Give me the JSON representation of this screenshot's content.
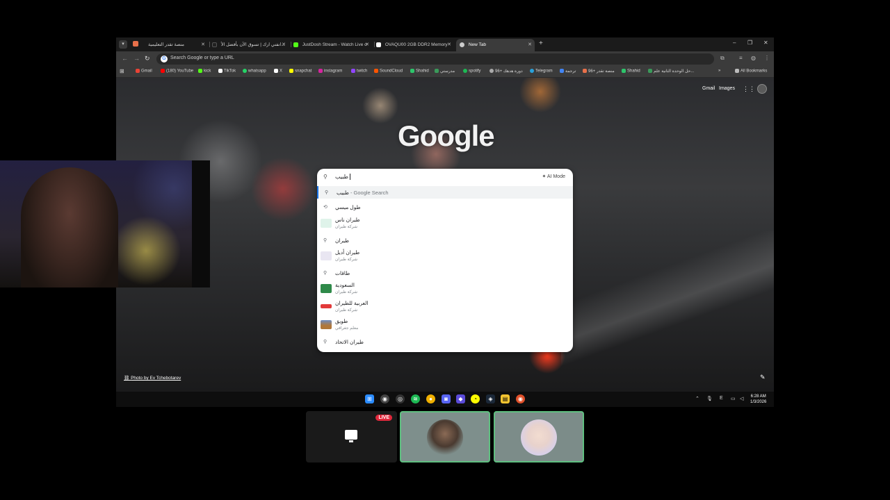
{
  "tabs": [
    {
      "title": "منصة تقدر التعليمية",
      "favicon_color": "#e8704a"
    },
    {
      "title": "انفني ارك | تسوق الآن بأفضل الأ...",
      "favicon_color": "#222222"
    },
    {
      "title": "JustDosh Stream - Watch Live o",
      "favicon_color": "#53fc18"
    },
    {
      "title": "OVAQU00 2GB DDR2 Memory",
      "favicon_color": "#ffffff"
    },
    {
      "title": "New Tab",
      "favicon_color": "#cccccc",
      "active": true
    }
  ],
  "omnibox": {
    "placeholder": "Search Google or type a URL"
  },
  "bookmarks": [
    {
      "label": "Gmail",
      "color": "#ea4335"
    },
    {
      "label": "(180) YouTube",
      "color": "#ff0000"
    },
    {
      "label": "kick",
      "color": "#53fc18"
    },
    {
      "label": "TikTok",
      "color": "#ffffff"
    },
    {
      "label": "whatsapp",
      "color": "#25d366"
    },
    {
      "label": "X",
      "color": "#ffffff"
    },
    {
      "label": "snapchat",
      "color": "#fffc00"
    },
    {
      "label": "instagram",
      "color": "#d6249f"
    },
    {
      "label": "twitch",
      "color": "#9146ff"
    },
    {
      "label": "SoundCloud",
      "color": "#ff5500"
    },
    {
      "label": "Shahid",
      "color": "#2ec46b"
    },
    {
      "label": "مدرستي",
      "color": "#3a9a5a"
    },
    {
      "label": "spotify",
      "color": "#1db954"
    },
    {
      "label": "دورة هدهك +96",
      "color": "#aaaaaa"
    },
    {
      "label": "Telegram",
      "color": "#2aa1da"
    },
    {
      "label": "ترجمة",
      "color": "#4285f4"
    },
    {
      "label": "منصة تقدر +96",
      "color": "#e8704a"
    },
    {
      "label": "Shahid",
      "color": "#2ec46b"
    },
    {
      "label": "حل الوحدة الثانية علم...",
      "color": "#3a9a5a"
    }
  ],
  "bookmarks_all": "All Bookmarks",
  "header_links": {
    "gmail": "Gmail",
    "images": "Images"
  },
  "logo_text": "Google",
  "photo_credit": "Photo by Ev Tchebotarev",
  "search": {
    "query": "طبيب",
    "ai_mode": "AI Mode"
  },
  "suggestions": [
    {
      "icon": "search",
      "text": "طبيب",
      "hint": " - Google Search",
      "selected": true
    },
    {
      "icon": "history",
      "text": "طول ميسي"
    },
    {
      "icon": "thumb",
      "text": "طيران ناس",
      "sub": "شركة طيران",
      "thumb_color": "#dff3ea"
    },
    {
      "icon": "search",
      "text": "طيران"
    },
    {
      "icon": "thumb",
      "text": "طيران أديل",
      "sub": "شركة طيران",
      "thumb_color": "#e9e6f2"
    },
    {
      "icon": "search",
      "text": "طاقات"
    },
    {
      "icon": "thumb",
      "text": "السعودية",
      "sub": "شركة طيران",
      "thumb_color": "#2f8a4a"
    },
    {
      "icon": "thumb",
      "text": "العربية للطيران",
      "sub": "شركة طيران",
      "thumb_color": "#e23a3a"
    },
    {
      "icon": "thumb",
      "text": "طويق",
      "sub": "معلم جغرافي",
      "thumb_color": "#b0773a"
    },
    {
      "icon": "search",
      "text": "طيران الاتحاد"
    }
  ],
  "taskbar": {
    "icons": [
      {
        "name": "windows-start",
        "color": "#2b8cff",
        "glyph": "⊞"
      },
      {
        "name": "chrome",
        "color": "#e0a020",
        "glyph": "◉"
      },
      {
        "name": "obs",
        "color": "#333333",
        "glyph": "◎"
      },
      {
        "name": "spotify",
        "color": "#1db954",
        "glyph": "≋"
      },
      {
        "name": "app-yellow",
        "color": "#f0b000",
        "glyph": "●"
      },
      {
        "name": "discord",
        "color": "#5865f2",
        "glyph": "◙"
      },
      {
        "name": "ai-app",
        "color": "#5b4bd8",
        "glyph": "◆"
      },
      {
        "name": "snapchat",
        "color": "#fffc00",
        "glyph": "◔"
      },
      {
        "name": "steam",
        "color": "#1b2838",
        "glyph": "◈"
      },
      {
        "name": "file-explorer",
        "color": "#f4c430",
        "glyph": "▤"
      },
      {
        "name": "app-red",
        "color": "#e0502a",
        "glyph": "◉"
      }
    ],
    "language": "E",
    "time": "6:28 AM",
    "date": "1/3/2026"
  },
  "stream": {
    "live_label": "LIVE"
  }
}
